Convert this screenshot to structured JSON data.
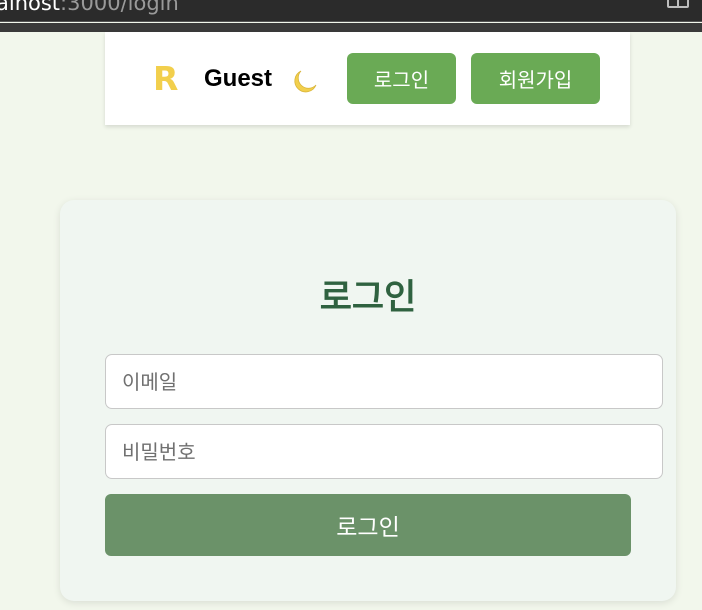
{
  "browser": {
    "url_host": "alhost",
    "url_path": ":3000/login"
  },
  "navbar": {
    "logo": "R",
    "user_name": "Guest",
    "theme_icon": "moon-icon",
    "login_label": "로그인",
    "signup_label": "회원가입"
  },
  "login_form": {
    "title": "로그인",
    "email_placeholder": "이메일",
    "password_placeholder": "비밀번호",
    "submit_label": "로그인"
  },
  "colors": {
    "page_background": "#f2f7ec",
    "logo": "#f2cf4c",
    "nav_button": "#6aaa55",
    "card_background": "#f0f6f1",
    "title": "#2f6240",
    "submit_button": "#6b9269",
    "moon": "#f2cf4c"
  }
}
